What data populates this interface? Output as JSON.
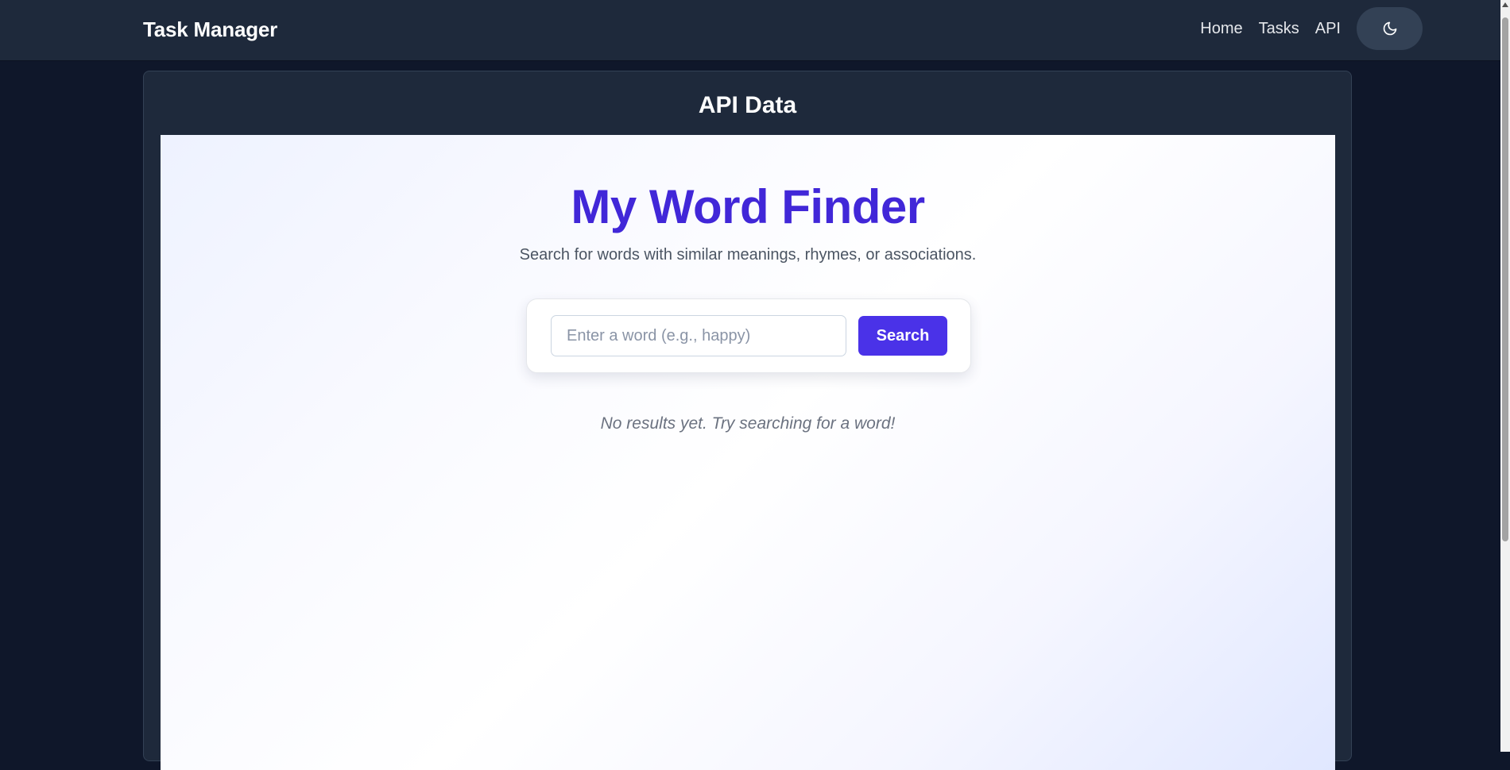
{
  "navbar": {
    "brand": "Task Manager",
    "links": [
      "Home",
      "Tasks",
      "API"
    ],
    "theme_toggle_icon": "moon-icon"
  },
  "card": {
    "title": "API Data"
  },
  "app": {
    "title": "My Word Finder",
    "subtitle": "Search for words with similar meanings, rhymes, or associations.",
    "search": {
      "placeholder": "Enter a word (e.g., happy)",
      "value": "",
      "button_label": "Search"
    },
    "empty_message": "No results yet. Try searching for a word!"
  },
  "colors": {
    "page_bg": "#0f172a",
    "nav_bg": "#1e293b",
    "accent": "#4a32e8",
    "title_color": "#4127d8"
  }
}
